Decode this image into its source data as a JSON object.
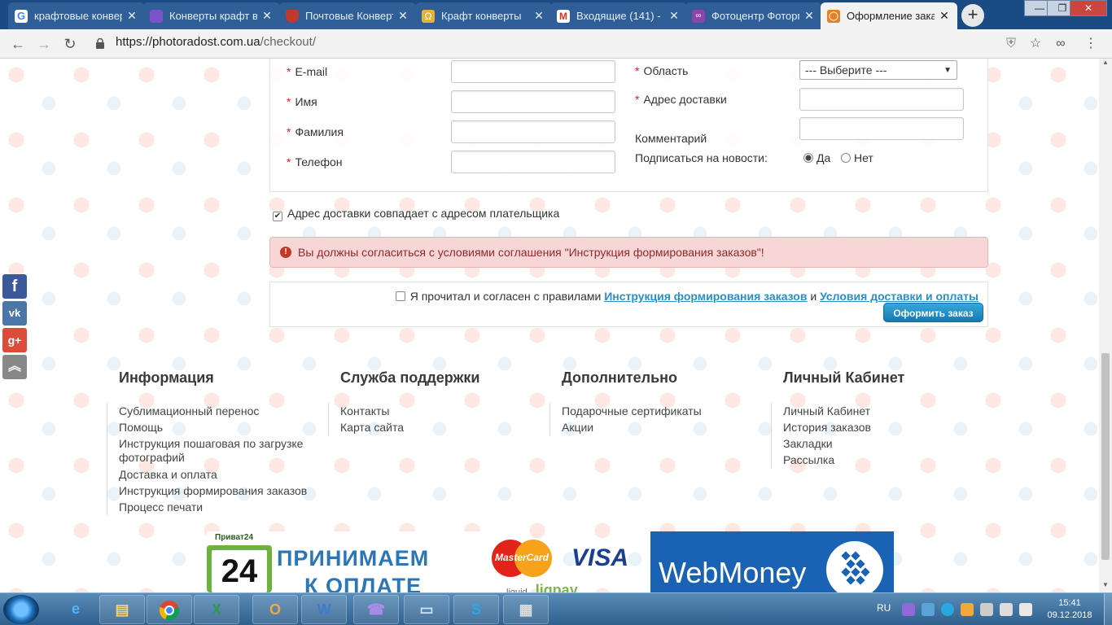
{
  "browser": {
    "tabs": [
      {
        "label": "крафтовые конверты",
        "icon": "google-icon",
        "color": "#ffffff"
      },
      {
        "label": "Конверты крафт в",
        "icon": "purple-square-icon",
        "color": "#7b52c7"
      },
      {
        "label": "Почтовые Конверт",
        "icon": "shield-icon",
        "color": "#c0392b"
      },
      {
        "label": "Крафт конверты",
        "icon": "omega-icon",
        "color": "#e4b43a"
      },
      {
        "label": "Входящие (141) -",
        "icon": "gmail-icon",
        "color": "#ffffff"
      },
      {
        "label": "Фотоцентр Фоторг",
        "icon": "photoradost-icon",
        "color": "#8e44ad"
      },
      {
        "label": "Оформление заказ",
        "icon": "sun-icon",
        "color": "#e67e22"
      }
    ],
    "new_tab": "+",
    "url_host": "https://photoradost.com.ua",
    "url_path": "/checkout/",
    "window_controls": {
      "minimize": "—",
      "maximize": "❐",
      "close": "✕"
    }
  },
  "form": {
    "email_label": "E-mail",
    "name_label": "Имя",
    "surname_label": "Фамилия",
    "phone_label": "Телефон",
    "region_label": "Область",
    "region_value": "--- Выберите ---",
    "address_label": "Адрес доставки",
    "comment_label": "Комментарий",
    "subscribe_label": "Подписаться на новости:",
    "subscribe_yes": "Да",
    "subscribe_no": "Нет",
    "required_mark": "*"
  },
  "same_address_label": "Адрес доставки совпадает с адресом плательщика",
  "alert_text": "Вы должны согласиться с условиями соглашения \"Инструкция формирования заказов\"!",
  "agree": {
    "prefix": "Я прочитал и согласен с правилами",
    "link1": "Инструкция формирования заказов",
    "and": "и",
    "link2": "Условия доставки и оплаты",
    "button": "Оформить заказ"
  },
  "social": [
    {
      "name": "facebook",
      "glyph": "f",
      "color": "#3b5998"
    },
    {
      "name": "vk",
      "glyph": "vk",
      "color": "#4a76a8"
    },
    {
      "name": "google-plus",
      "glyph": "g+",
      "color": "#dd4b39"
    },
    {
      "name": "scroll-top",
      "glyph": "︽",
      "color": "#888888"
    }
  ],
  "footer": {
    "col1": {
      "title": "Информация",
      "items": [
        "Сублимационный перенос",
        "Помощь",
        "Инструкция пошаговая по загрузке фотографий",
        "Доставка и оплата",
        "Инструкция формирования заказов",
        "Процесс печати"
      ]
    },
    "col2": {
      "title": "Служба поддержки",
      "items": [
        "Контакты",
        "Карта сайта"
      ]
    },
    "col3": {
      "title": "Дополнительно",
      "items": [
        "Подарочные сертификаты",
        "Акции"
      ]
    },
    "col4": {
      "title": "Личный Кабинет",
      "items": [
        "Личный Кабинет",
        "История заказов",
        "Закладки",
        "Рассылка"
      ]
    }
  },
  "payments": {
    "privat_brand": "Приват24",
    "privat_number": "24",
    "accept_line1": "ПРИНИМАЕМ",
    "accept_line2": "К ОПЛАТЕ",
    "mastercard": "MasterCard",
    "visa": "VISA",
    "liqpay_prefix": "liquid",
    "liqpay": "liqpay",
    "webmoney": "WebMoney"
  },
  "taskbar": {
    "apps": [
      "explorer",
      "internet-explorer",
      "chrome",
      "excel",
      "outlook",
      "word",
      "viber",
      "network",
      "skype",
      "calculator"
    ],
    "lang": "RU",
    "time": "15:41",
    "date": "09.12.2018"
  }
}
